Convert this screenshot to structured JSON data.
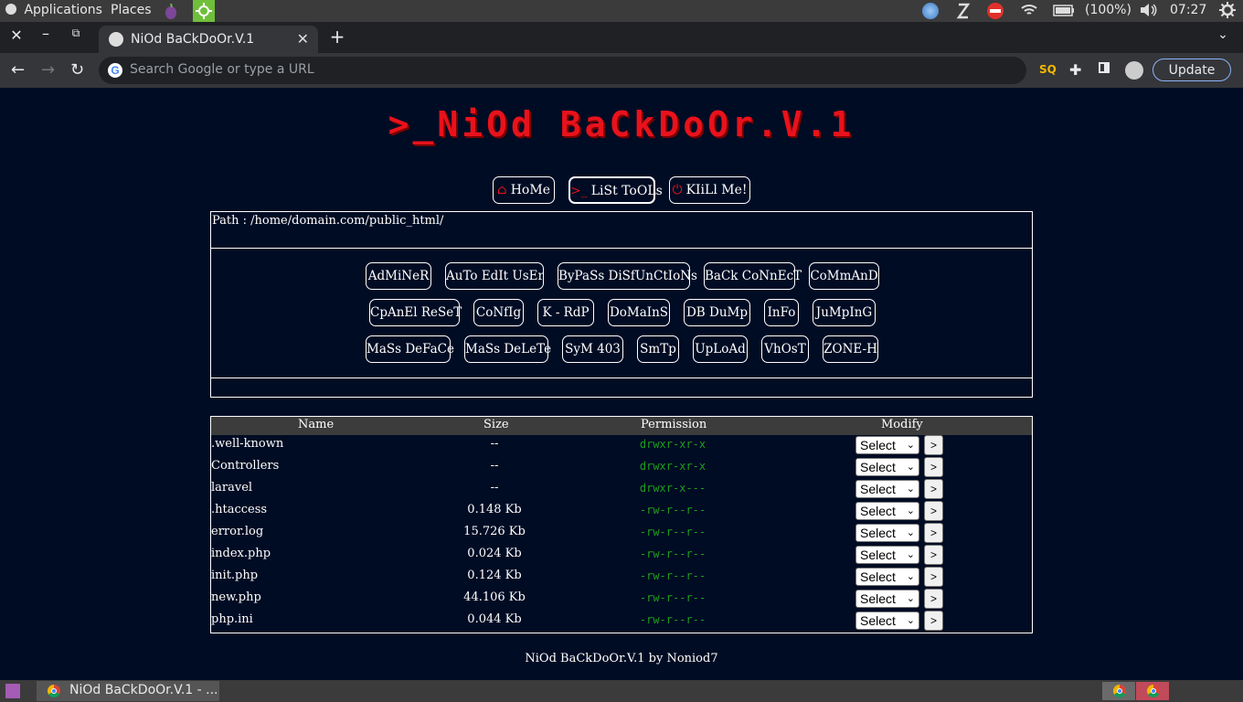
{
  "system_bar": {
    "applications": "Applications",
    "places": "Places",
    "battery": "(100%)",
    "time": "07:27"
  },
  "browser": {
    "tab_title": "NiOd BaCkDoOr.V.1",
    "omnibox_placeholder": "Search Google or type a URL",
    "update_label": "Update"
  },
  "page": {
    "banner": ">_NiOd BaCkDoOr.V.1",
    "nav": [
      {
        "label": "HoMe",
        "icon": "home-icon"
      },
      {
        "label": "LiSt ToOLs",
        "icon": "terminal-icon"
      },
      {
        "label": "KIiLl Me!",
        "icon": "power-icon"
      }
    ],
    "path": "Path : /home/domain.com/public_html/",
    "tools": [
      [
        "AdMiNeR",
        "AuTo EdIt UsEr",
        "ByPaSs DiSfUnCtIoNs",
        "BaCk CoNnEcT",
        "CoMmAnD"
      ],
      [
        "CpAnEl ReSeT",
        "CoNfIg",
        "K - RdP",
        "DoMaInS",
        "DB DuMp",
        "InFo",
        "JuMpInG"
      ],
      [
        "MaSs DeFaCe",
        "MaSs DeLeTe",
        "SyM 403",
        "SmTp",
        "UpLoAd",
        "VhOsT",
        "ZONE-H"
      ]
    ],
    "table": {
      "headers": {
        "name": "Name",
        "size": "Size",
        "permission": "Permission",
        "modify": "Modify"
      },
      "select_label": "Select",
      "go_label": ">",
      "rows": [
        {
          "name": ".well-known",
          "size": "--",
          "perm": "drwxr-xr-x"
        },
        {
          "name": "Controllers",
          "size": "--",
          "perm": "drwxr-xr-x"
        },
        {
          "name": "laravel",
          "size": "--",
          "perm": "drwxr-x---"
        },
        {
          "name": ".htaccess",
          "size": "0.148 Kb",
          "perm": "-rw-r--r--"
        },
        {
          "name": "error.log",
          "size": "15.726 Kb",
          "perm": "-rw-r--r--"
        },
        {
          "name": "index.php",
          "size": "0.024 Kb",
          "perm": "-rw-r--r--"
        },
        {
          "name": "init.php",
          "size": "0.124 Kb",
          "perm": "-rw-r--r--"
        },
        {
          "name": "new.php",
          "size": "44.106 Kb",
          "perm": "-rw-r--r--"
        },
        {
          "name": "php.ini",
          "size": "0.044 Kb",
          "perm": "-rw-r--r--"
        }
      ]
    },
    "footer": "NiOd BaCkDoOr.V.1 by Noniod7"
  },
  "taskbar": {
    "window_label": "NiOd BaCkDoOr.V.1 - ..."
  }
}
